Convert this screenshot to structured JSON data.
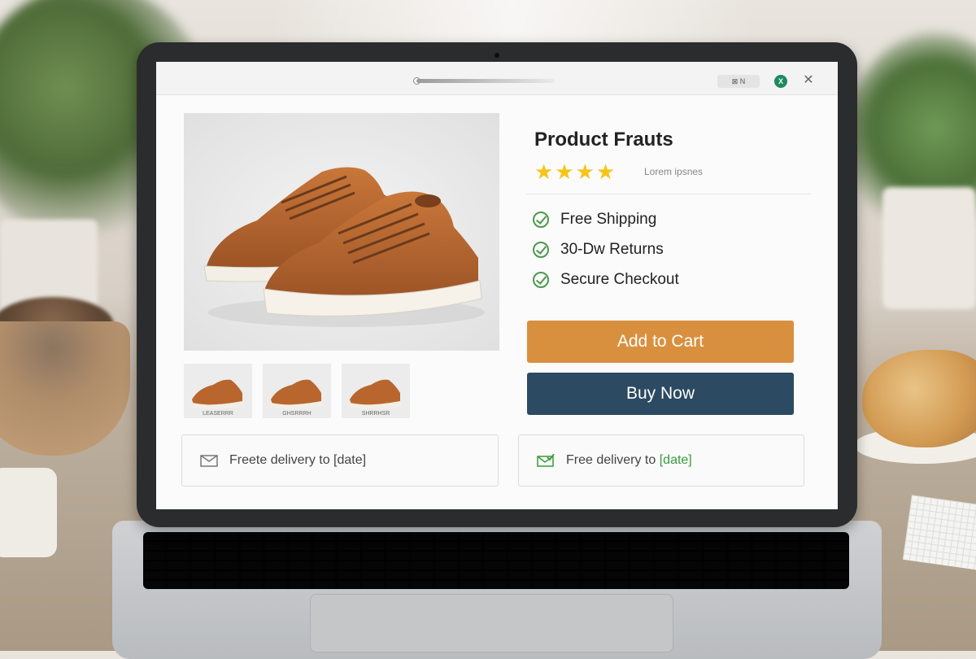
{
  "browser": {
    "extension_label": "⊠ N",
    "profile_initial": "X",
    "close_label": "✕"
  },
  "product": {
    "title": "Product Frauts",
    "stars": "★★★★",
    "rating_text": "Lorem ipsnes",
    "thumbnails": [
      {
        "caption": "LEASERRR"
      },
      {
        "caption": "GHSRRRH"
      },
      {
        "caption": "SHRRHSR"
      }
    ],
    "features": [
      {
        "label": "Free Shipping"
      },
      {
        "label": "30-Dw Returns"
      },
      {
        "label": "Secure Checkout"
      }
    ],
    "add_to_cart_label": "Add to Cart",
    "buy_now_label": "Buy Now"
  },
  "delivery": {
    "left": {
      "text": "Freete delivery to [date]"
    },
    "right": {
      "prefix": "Free delivery to",
      "date": "[date]"
    }
  },
  "colors": {
    "add_to_cart": "#d9903e",
    "buy_now": "#2c4a62",
    "star": "#f5c518",
    "check": "#4a9a4a",
    "profile": "#1e8a5e"
  }
}
